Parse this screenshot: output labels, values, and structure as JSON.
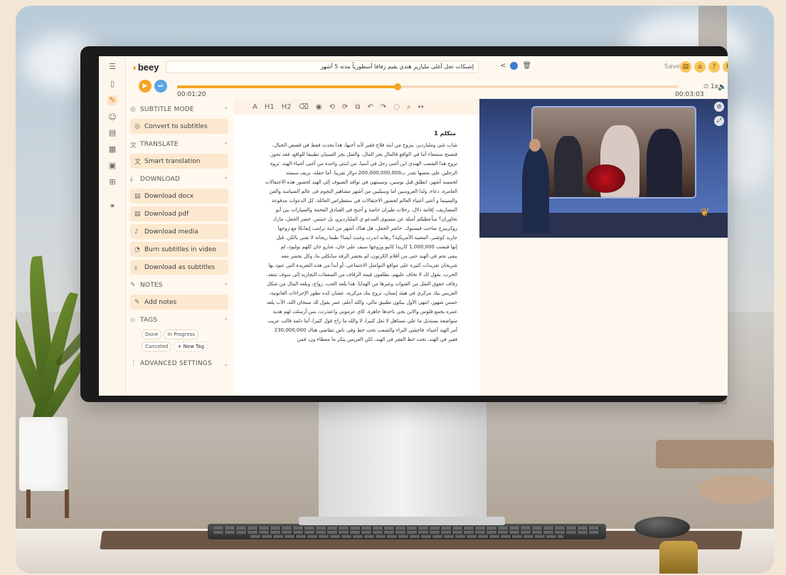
{
  "app": {
    "logo": "beey",
    "document_title": "إشبكات تجل أغلى مليارير هندي يقيم زفافا أسطورياً مدته 5 أشهر",
    "saved_status": "Saved ✓",
    "toolbar_buttons": [
      "list-icon",
      "cart-icon",
      "help-icon",
      "user-icon"
    ],
    "help_label": "?",
    "user_initial": "R",
    "accent_color": "#f5a623",
    "secondary_color": "#5ba4e8"
  },
  "player": {
    "current_time": "00:01:20",
    "total_time": "00:03:03",
    "progress": 0.44,
    "speed": "1x"
  },
  "panel": {
    "subtitle_mode": {
      "heading": "SUBTITLE MODE",
      "action": "Convert to subtitles"
    },
    "translate": {
      "heading": "TRANSLATE",
      "action": "Smart translation"
    },
    "download": {
      "heading": "DOWNLOAD",
      "actions": [
        "Download docx",
        "Download pdf",
        "Download media",
        "Burn subtitles in video",
        "Download as subtitles"
      ]
    },
    "notes": {
      "heading": "NOTES",
      "action": "Add notes"
    },
    "tags": {
      "heading": "TAGS",
      "items": [
        "Done",
        "In Progress",
        "Canceled"
      ],
      "new_tag": "+ New Tag"
    },
    "advanced": {
      "heading": "ADVANCED SETTINGS"
    }
  },
  "editor": {
    "toolbar_labels": [
      "A",
      "H1",
      "H2"
    ],
    "speaker": "متكلم 1",
    "lines": [
      "شاب غني وملياردير، يتزوج من ابنة فلاح فقير لأنه أحبها، هذا يحدث فقط في قصص الخيال،",
      "فتصبح ستمعاء أما في الواقع فالمال يجر المال، والفتل يجر الصبيان تطبيقا للواقع، فقد تجوز.",
      "تزوج هذا الشعب الهندي ابن أغنى رجل في آسيا، من ابنتي واحدة من أغنى أغنياء الهند. ثروة",
      "الرجلين على بعضها تقدر ب200,000,000,000 دولار تقريبا. أما حفله، بزيف سيمتد",
      "لخمسة أشهر، انطلق قبل بوسين، وسينتهي في توافد الضيوف إلى الهند لحضور هذه الاحتفالات",
      "العامرة، دعاء، ولذا العروسين أما وسيليين من أشهر مشاهير النجوم في عالم السياسة والفن",
      "والسينما و أغنى أغنياء العالم لحضور الاحتفالات في سقطراس العائلة، كل الدعوات مدفوعة",
      "المصاريف، إقامة دلال، رحلات طيران خاصة و أجنح في الفنادق الفخمة والسيارات بين أبو",
      "تحاوران؟ سأعطيكم أمثلة عن مستوى المدعو ي المليارديرو، بل جيتس. حضر الحفل، مارك",
      "زوكربيرج صاحب فيسبوك. حاضر الحفل، هل هناك أشهر من ابنة ترامب إيفانكا مع زوجها",
      "جاريد كوشنر، المغنية الأمريكية؟ رهانه اندرت وغنت أيضا؟ طبعا ريحانة لا تغني بالكن. قبل",
      "إنها قبضت 1,000,000 كاريذا كانيو وزوجها سيف علي خان، شارو خان كلهم بوليود، لم",
      "يبقى نجم في الهند حتى من أفلام الكرتون، لم يحضر الزفة سابكلي ما، وكل يحضر معه",
      "شريحان تغريدات كثيرة على مواقع التواصل الاجتماعي، أو أبدأ من هذه التغريدة التي عبود بها",
      "الحرب، يقول لك لا تخاف عليهم، يطلعون قيمة الزفاف من الصفقات التجارية إلى سوف تنتقد،",
      "زفاف حقوق النقل من القنوات وغيرها من الهدايا. هذا بلغة الحب، زواج، وبلغة المال من شكل",
      "العريس بنك مركزي في هيئة إنسان، تزوج بنك مركزية، عشان كده تطور الإجراءات القانونية،",
      "خمس شهور، انتهى الأول بيكون تطبيق مالي، والله أعلم، عمر يقول لك سبحان الله، الأب يلعد",
      "عمره يجمع قلوس والابن يجي باخدها جاهزة، كاي عزموني واعتذرت، بس أرسلت لهم هدية",
      "متواضعة بستديل ما علي تستاهل لا تقل كثيرا، لا والله ما راح قول كثيرا، أما دلمة قالت عريب",
      "أمر الهند أغنياء، فاحشي الثراء والشعب تحت خط وفي ناس تتقاضى هناك 230,000,000",
      "فقير في الهند، تحت خط الفقر في الهند، لكن العريس يتكر ما معطاء ون، فمن"
    ]
  }
}
